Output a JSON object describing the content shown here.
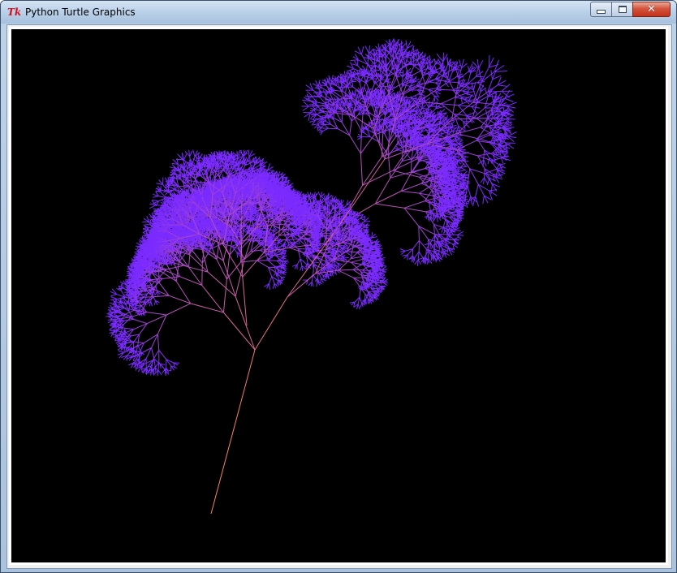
{
  "window": {
    "title": "Python Turtle Graphics",
    "app_icon": "tk-icon"
  },
  "title_buttons": {
    "minimize": "minimize-icon",
    "maximize": "maximize-icon",
    "close": "close-icon"
  },
  "canvas": {
    "background": "#000000",
    "drawing": "fractal-tree",
    "trunk_color": "#ff7f66",
    "tip_color": "#7a2bff"
  }
}
